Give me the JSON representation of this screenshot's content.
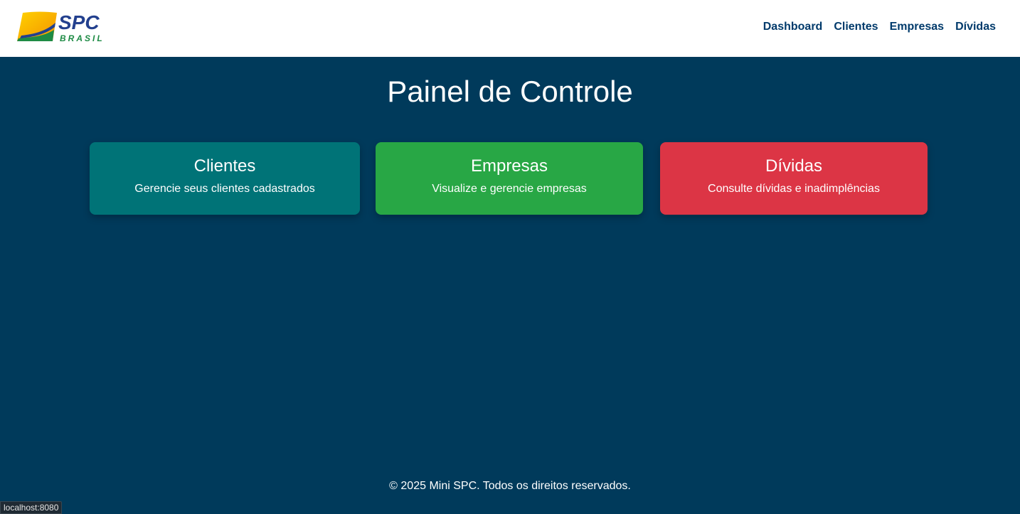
{
  "header": {
    "logo": {
      "text_main": "SPC",
      "text_sub": "BRASIL",
      "icon": "spc-brasil-logo"
    },
    "nav": [
      {
        "label": "Dashboard"
      },
      {
        "label": "Clientes"
      },
      {
        "label": "Empresas"
      },
      {
        "label": "Dívidas"
      }
    ]
  },
  "main": {
    "title": "Painel de Controle",
    "cards": [
      {
        "title": "Clientes",
        "desc": "Gerencie seus clientes cadastrados",
        "color": "#007377"
      },
      {
        "title": "Empresas",
        "desc": "Visualize e gerencie empresas",
        "color": "#28a745"
      },
      {
        "title": "Dívidas",
        "desc": "Consulte dívidas e inadimplências",
        "color": "#dc3545"
      }
    ]
  },
  "footer": {
    "text": "© 2025 Mini SPC. Todos os direitos reservados."
  },
  "statusbar": {
    "url": "localhost:8080"
  },
  "colors": {
    "background": "#003a5b",
    "nav_text": "#003a6b",
    "header_bg": "#ffffff"
  }
}
